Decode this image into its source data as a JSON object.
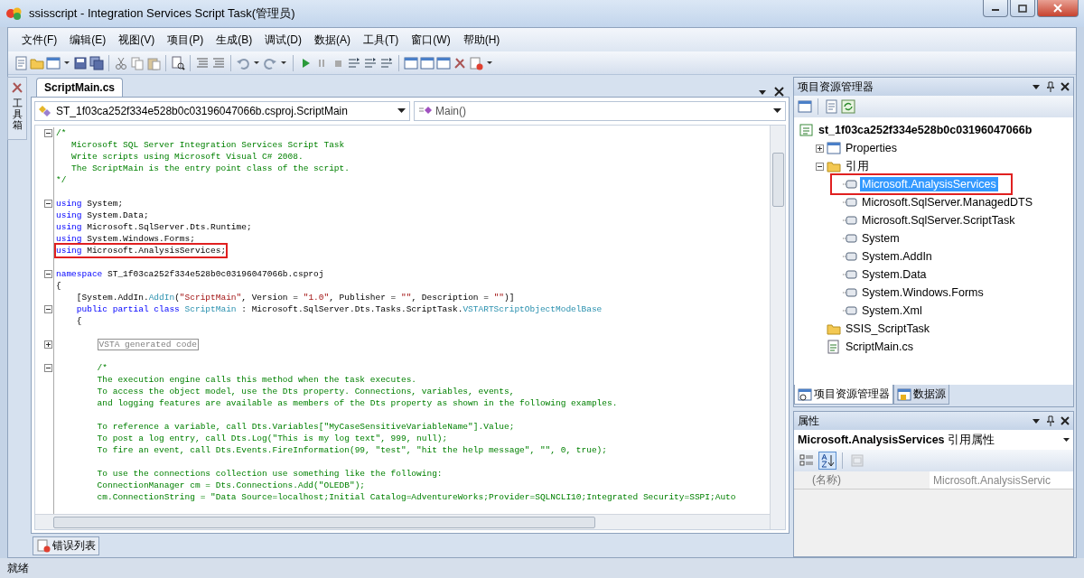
{
  "window": {
    "title": "ssisscript - Integration Services Script Task(管理员)"
  },
  "menu": [
    "文件(F)",
    "编辑(E)",
    "视图(V)",
    "项目(P)",
    "生成(B)",
    "调试(D)",
    "数据(A)",
    "工具(T)",
    "窗口(W)",
    "帮助(H)"
  ],
  "toolbox": {
    "label": "工具箱"
  },
  "document_tabs": [
    {
      "label": "ScriptMain.cs",
      "selected": true
    }
  ],
  "navigation": {
    "type_dropdown": "ST_1f03ca252f334e528b0c03196047066b.csproj.ScriptMain",
    "member_dropdown": "Main()"
  },
  "code_lines": [
    {
      "kind": "code",
      "expanded": true,
      "tokens": [
        {
          "kind": "comment",
          "text": "/*"
        }
      ]
    },
    {
      "tokens": [
        {
          "kind": "comment",
          "text": "   Microsoft SQL Server Integration Services Script Task"
        }
      ]
    },
    {
      "tokens": [
        {
          "kind": "comment",
          "text": "   Write scripts using Microsoft Visual C# 2008."
        }
      ]
    },
    {
      "tokens": [
        {
          "kind": "comment",
          "text": "   The ScriptMain is the entry point class of the script."
        }
      ]
    },
    {
      "tokens": [
        {
          "kind": "comment",
          "text": "*/"
        }
      ]
    },
    {
      "kind": "blank"
    },
    {
      "kind": "code",
      "expanded": true,
      "tokens": [
        {
          "kind": "keyword",
          "text": "using"
        },
        {
          "kind": "plain",
          "text": " System;"
        }
      ]
    },
    {
      "tokens": [
        {
          "kind": "keyword",
          "text": "using"
        },
        {
          "kind": "plain",
          "text": " System.Data;"
        }
      ]
    },
    {
      "tokens": [
        {
          "kind": "keyword",
          "text": "using"
        },
        {
          "kind": "plain",
          "text": " Microsoft.SqlServer.Dts.Runtime;"
        }
      ]
    },
    {
      "tokens": [
        {
          "kind": "keyword",
          "text": "using"
        },
        {
          "kind": "plain",
          "text": " System.Windows.Forms;"
        }
      ]
    },
    {
      "annotated": true,
      "tokens": [
        {
          "kind": "keyword",
          "text": "using"
        },
        {
          "kind": "plain",
          "text": " Microsoft.AnalysisServices;"
        }
      ]
    },
    {
      "kind": "blank"
    },
    {
      "kind": "code",
      "expanded": true,
      "tokens": [
        {
          "kind": "keyword",
          "text": "namespace"
        },
        {
          "kind": "plain",
          "text": " ST_1f03ca252f334e528b0c03196047066b.csproj"
        }
      ]
    },
    {
      "tokens": [
        {
          "kind": "plain",
          "text": "{"
        }
      ]
    },
    {
      "tokens": [
        {
          "kind": "plain",
          "text": "    [System.AddIn."
        },
        {
          "kind": "type",
          "text": "AddIn"
        },
        {
          "kind": "plain",
          "text": "("
        },
        {
          "kind": "string",
          "text": "\"ScriptMain\""
        },
        {
          "kind": "plain",
          "text": ", Version = "
        },
        {
          "kind": "string",
          "text": "\"1.0\""
        },
        {
          "kind": "plain",
          "text": ", Publisher = "
        },
        {
          "kind": "string",
          "text": "\"\""
        },
        {
          "kind": "plain",
          "text": ", Description = "
        },
        {
          "kind": "string",
          "text": "\"\""
        },
        {
          "kind": "plain",
          "text": ")]"
        }
      ]
    },
    {
      "kind": "code",
      "expanded": true,
      "tokens": [
        {
          "kind": "keyword",
          "text": "    public partial class"
        },
        {
          "kind": "type",
          "text": " ScriptMain"
        },
        {
          "kind": "plain",
          "text": " : Microsoft.SqlServer.Dts.Tasks.ScriptTask."
        },
        {
          "kind": "type",
          "text": "VSTARTScriptObjectModelBase"
        }
      ]
    },
    {
      "tokens": [
        {
          "kind": "plain",
          "text": "    {"
        }
      ]
    },
    {
      "kind": "blank"
    },
    {
      "kind": "code",
      "expanded": false,
      "tokens": [
        {
          "kind": "collapsed",
          "text": "VSTA generated code"
        }
      ]
    },
    {
      "kind": "blank"
    },
    {
      "kind": "code",
      "expanded": true,
      "tokens": [
        {
          "kind": "comment",
          "text": "        /*"
        }
      ]
    },
    {
      "tokens": [
        {
          "kind": "comment",
          "text": "        The execution engine calls this method when the task executes."
        }
      ]
    },
    {
      "tokens": [
        {
          "kind": "comment",
          "text": "        To access the object model, use the Dts property. Connections, variables, events,"
        }
      ]
    },
    {
      "tokens": [
        {
          "kind": "comment",
          "text": "        and logging features are available as members of the Dts property as shown in the following examples."
        }
      ]
    },
    {
      "kind": "blank"
    },
    {
      "tokens": [
        {
          "kind": "comment",
          "text": "        To reference a variable, call Dts.Variables[\"MyCaseSensitiveVariableName\"].Value;"
        }
      ]
    },
    {
      "tokens": [
        {
          "kind": "comment",
          "text": "        To post a log entry, call Dts.Log(\"This is my log text\", 999, null);"
        }
      ]
    },
    {
      "tokens": [
        {
          "kind": "comment",
          "text": "        To fire an event, call Dts.Events.FireInformation(99, \"test\", \"hit the help message\", \"\", 0, true);"
        }
      ]
    },
    {
      "kind": "blank"
    },
    {
      "tokens": [
        {
          "kind": "comment",
          "text": "        To use the connections collection use something like the following:"
        }
      ]
    },
    {
      "tokens": [
        {
          "kind": "comment",
          "text": "        ConnectionManager cm = Dts.Connections.Add(\"OLEDB\");"
        }
      ]
    },
    {
      "tokens": [
        {
          "kind": "comment",
          "text": "        cm.ConnectionString = \"Data Source=localhost;Initial Catalog=AdventureWorks;Provider=SQLNCLI10;Integrated Security=SSPI;Auto"
        }
      ]
    }
  ],
  "bottom_tabs": [
    {
      "label": "错误列表"
    }
  ],
  "solution_explorer": {
    "title": "项目资源管理器",
    "tree": [
      {
        "kind": "project",
        "label": "st_1f03ca252f334e528b0c03196047066b",
        "selected": false,
        "children": [
          {
            "kind": "properties",
            "label": "Properties",
            "selected": false,
            "expanded": false
          },
          {
            "kind": "folder",
            "label": "引用",
            "selected": false,
            "expanded": true,
            "children": [
              {
                "kind": "reference",
                "label": "Microsoft.AnalysisServices",
                "selected": true,
                "annotated": true
              },
              {
                "kind": "reference",
                "label": "Microsoft.SqlServer.ManagedDTS",
                "selected": false
              },
              {
                "kind": "reference",
                "label": "Microsoft.SqlServer.ScriptTask",
                "selected": false
              },
              {
                "kind": "reference",
                "label": "System",
                "selected": false
              },
              {
                "kind": "reference",
                "label": "System.AddIn",
                "selected": false
              },
              {
                "kind": "reference",
                "label": "System.Data",
                "selected": false
              },
              {
                "kind": "reference",
                "label": "System.Windows.Forms",
                "selected": false
              },
              {
                "kind": "reference",
                "label": "System.Xml",
                "selected": false
              }
            ]
          },
          {
            "kind": "folder",
            "label": "SSIS_ScriptTask",
            "selected": false
          },
          {
            "kind": "csfile",
            "label": "ScriptMain.cs",
            "selected": false
          }
        ]
      }
    ]
  },
  "panel_tabs": [
    {
      "label": "项目资源管理器",
      "selected": true
    },
    {
      "label": "数据源",
      "selected": false
    }
  ],
  "properties": {
    "title": "属性",
    "object": "**Microsoft.AnalysisServices** 引用属性",
    "toolbar": [
      {
        "kind": "categorized",
        "selected": false,
        "disabled": false
      },
      {
        "kind": "alphabetical",
        "selected": true,
        "disabled": false
      },
      {
        "kind": "property-pages",
        "selected": false,
        "disabled": true
      }
    ],
    "rows": [
      {
        "name": "(名称)",
        "value": "Microsoft.AnalysisServic"
      }
    ]
  },
  "status_bar": {
    "text": "就绪"
  }
}
